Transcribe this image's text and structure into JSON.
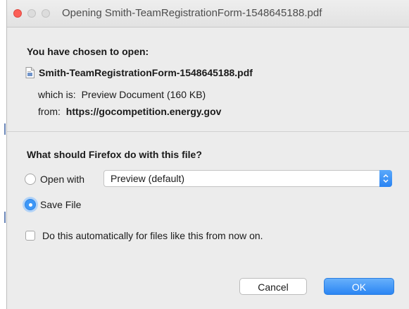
{
  "window": {
    "title": "Opening Smith-TeamRegistrationForm-1548645188.pdf"
  },
  "dialog": {
    "heading": "You have chosen to open:",
    "file_name": "Smith-TeamRegistrationForm-1548645188.pdf",
    "file_type_label": "which is:",
    "file_type_value": "Preview Document (160 KB)",
    "source_label": "from:",
    "source_url": "https://gocompetition.energy.gov",
    "question": "What should Firefox do with this file?"
  },
  "options": {
    "open_with_label": "Open with",
    "open_with_app": "Preview (default)",
    "open_with_selected": false,
    "save_file_label": "Save File",
    "save_file_selected": true,
    "auto_label": "Do this automatically for files like this from now on.",
    "auto_checked": false
  },
  "buttons": {
    "cancel": "Cancel",
    "ok": "OK"
  },
  "icons": {
    "window_close": "close-dot-icon",
    "window_minimize": "minimize-dot-icon",
    "window_maximize": "maximize-dot-icon",
    "file": "document-icon",
    "select_arrow": "chevron-up-down-icon"
  },
  "colors": {
    "accent": "#3d97f7",
    "close_red": "#fc5f57",
    "dialog_bg": "#ececec"
  }
}
